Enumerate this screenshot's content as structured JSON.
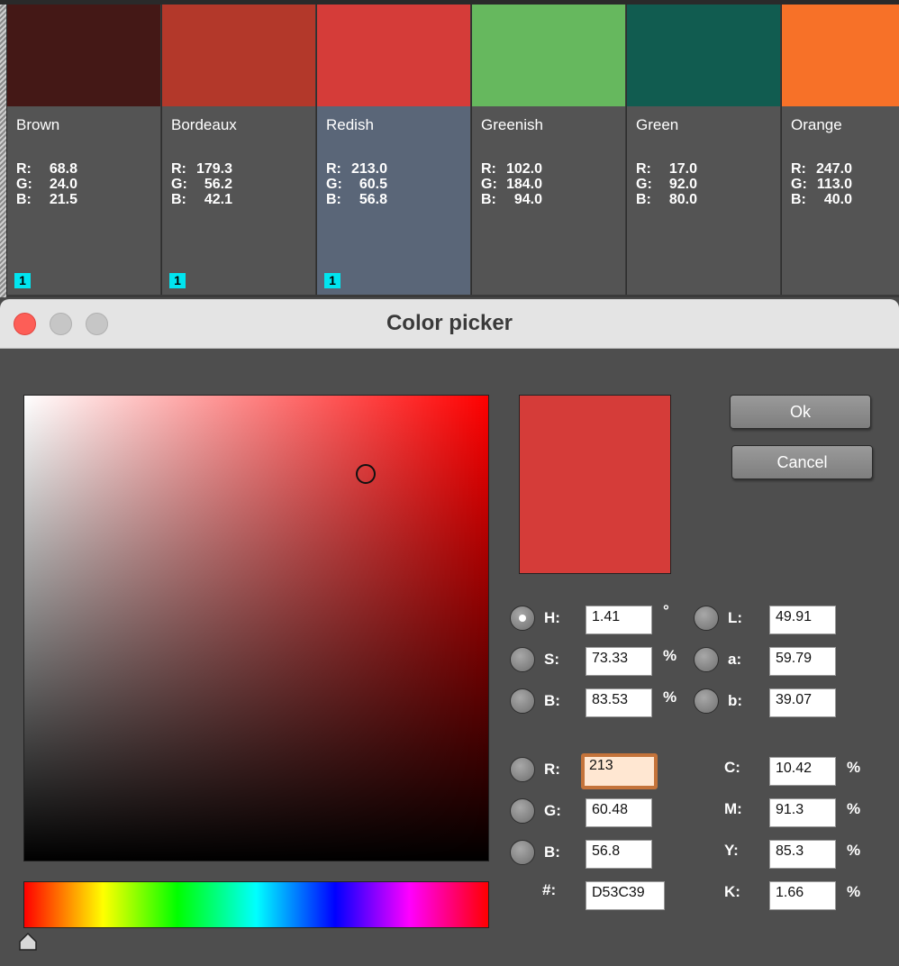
{
  "swatches": [
    {
      "name": "Brown",
      "r": "68.8",
      "g": "24.0",
      "b": "21.5",
      "color": "#441816",
      "badge": "1",
      "selected": false
    },
    {
      "name": "Bordeaux",
      "r": "179.3",
      "g": "56.2",
      "b": "42.1",
      "color": "#b3382a",
      "badge": "1",
      "selected": false
    },
    {
      "name": "Redish",
      "r": "213.0",
      "g": "60.5",
      "b": "56.8",
      "color": "#d53c39",
      "badge": "1",
      "selected": true
    },
    {
      "name": "Greenish",
      "r": "102.0",
      "g": "184.0",
      "b": "94.0",
      "color": "#66b85e",
      "badge": "",
      "selected": false
    },
    {
      "name": "Green",
      "r": "17.0",
      "g": "92.0",
      "b": "80.0",
      "color": "#115c50",
      "badge": "",
      "selected": false
    },
    {
      "name": "Orange",
      "r": "247.0",
      "g": "113.0",
      "b": "40.0",
      "color": "#f77128",
      "badge": "",
      "selected": false
    }
  ],
  "rgb_labels": {
    "r": "R:",
    "g": "G:",
    "b": "B:"
  },
  "dialog": {
    "title": "Color picker",
    "ok_label": "Ok",
    "cancel_label": "Cancel",
    "current_color": "#d53c39",
    "hue_position": 0.0
  },
  "fields": {
    "h": {
      "label": "H:",
      "value": "1.41",
      "unit": "°",
      "selected": true
    },
    "s": {
      "label": "S:",
      "value": "73.33",
      "unit": "%"
    },
    "bright": {
      "label": "B:",
      "value": "83.53",
      "unit": "%"
    },
    "l": {
      "label": "L:",
      "value": "49.91"
    },
    "a": {
      "label": "a:",
      "value": "59.79"
    },
    "lab_b": {
      "label": "b:",
      "value": "39.07"
    },
    "r": {
      "label": "R:",
      "value": "213"
    },
    "g": {
      "label": "G:",
      "value": "60.48"
    },
    "b": {
      "label": "B:",
      "value": "56.8"
    },
    "hex": {
      "label": "#:",
      "value": "D53C39"
    },
    "c": {
      "label": "C:",
      "value": "10.42",
      "unit": "%"
    },
    "m": {
      "label": "M:",
      "value": "91.3",
      "unit": "%"
    },
    "y": {
      "label": "Y:",
      "value": "85.3",
      "unit": "%"
    },
    "k": {
      "label": "K:",
      "value": "1.66",
      "unit": "%"
    }
  }
}
